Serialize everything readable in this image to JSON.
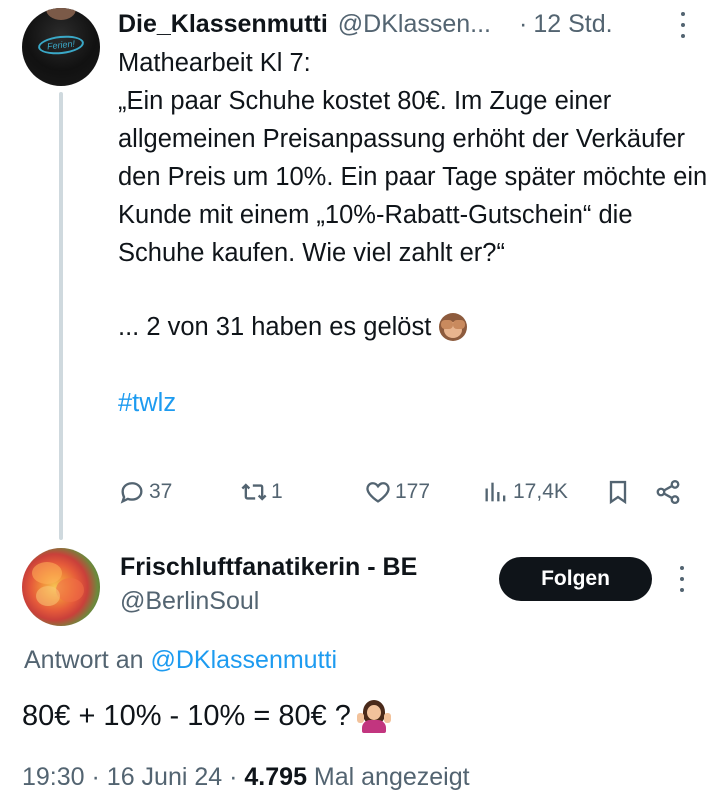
{
  "original_tweet": {
    "author_name": "Die_Klassenmutti",
    "author_handle": "@DKlassen...",
    "separator": "·",
    "time": "12 Std.",
    "avatar_shirt_text": "Ferien!",
    "text_title": "Mathearbeit Kl 7:",
    "text_question": "„Ein paar Schuhe kostet 80€. Im Zuge einer allgemeinen Preisanpassung erhöht der Verkäufer den Preis um 10%. Ein paar Tage später möchte ein Kunde mit einem „10%-Rabatt-Gutschein“ die Schuhe kaufen. Wie viel zahlt er?“",
    "text_result": "... 2 von 31 haben es gelöst",
    "result_emoji_icon": "see-no-evil-monkey-icon",
    "hashtag": "#twlz",
    "actions": {
      "replies": "37",
      "retweets": "1",
      "likes": "177",
      "views": "17,4K"
    }
  },
  "reply": {
    "author_name": "Frischluftfanatikerin - BE",
    "author_handle": "@BerlinSoul",
    "follow_label": "Folgen",
    "reply_to_prefix": "Antwort an",
    "reply_to_mention": "@DKlassenmutti",
    "text": "80€ + 10% - 10% = 80€ ?",
    "text_emoji_icon": "person-shrugging-icon",
    "meta": {
      "time": "19:30",
      "sep1": "·",
      "date": "16 Juni 24",
      "sep2": "·",
      "views_count": "4.795",
      "views_label": "Mal angezeigt"
    }
  },
  "colors": {
    "text_primary": "#0f1419",
    "text_secondary": "#536471",
    "link": "#1d9bf0",
    "thread_line": "#cfd9de",
    "button_bg": "#0f1419"
  }
}
